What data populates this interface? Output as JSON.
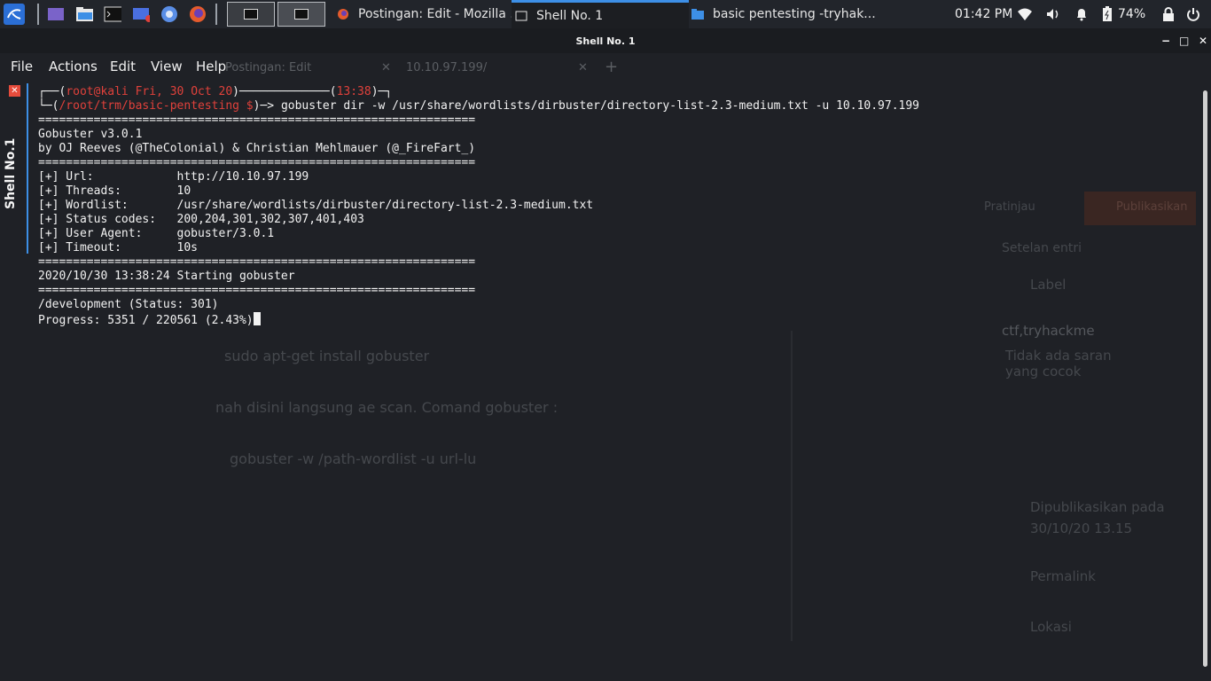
{
  "panel": {
    "taskbar": [
      {
        "label": "Postingan: Edit - Mozilla ...",
        "icon": "firefox-icon"
      },
      {
        "label": "Shell No. 1",
        "icon": "terminal-icon",
        "active": true
      },
      {
        "label": "basic pentesting -tryhak...",
        "icon": "folder-icon"
      }
    ],
    "clock": "01:42 PM",
    "battery": "74%"
  },
  "window": {
    "title": "Shell No. 1",
    "minimize": "−",
    "maximize": "□",
    "close": "✕"
  },
  "menu": {
    "file": "File",
    "actions": "Actions",
    "edit": "Edit",
    "view": "View",
    "help": "Help"
  },
  "side_tab": {
    "label": "Shell No.1",
    "close": "✕"
  },
  "background_ghost": {
    "tab1": "Postingan: Edit",
    "tab2": "10.10.97.199/",
    "sidebar_heading": "Setelan entri",
    "label_section": "Label",
    "tag": "ctf,tryhackme",
    "no_suggestion": "Tidak ada saran yang cocok",
    "published": "Dipublikasikan pada 30/10/20 13.15",
    "permalink": "Permalink",
    "location": "Lokasi",
    "post_line1": "sudo apt-get install gobuster",
    "post_line2": "nah disini langsung ae scan. Comand gobuster :",
    "post_line3": "gobuster -w /path-wordlist -u url-lu",
    "publish": "Publikasikan",
    "preview": "Pratinjau"
  },
  "terminal": {
    "prompt_line1": {
      "pre": "┌──(",
      "userhost": "root@kali Fri, 30 Oct 20",
      "mid": ")─────────────(",
      "time": "13:38",
      "post": ")─┐"
    },
    "prompt_line2": {
      "pre": "└─(",
      "path": "/root/trm/basic-pentesting $",
      "post": ")─> ",
      "command": "gobuster dir -w /usr/share/wordlists/dirbuster/directory-list-2.3-medium.txt -u 10.10.97.199"
    },
    "output": [
      "===============================================================",
      "Gobuster v3.0.1",
      "by OJ Reeves (@TheColonial) & Christian Mehlmauer (@_FireFart_)",
      "===============================================================",
      "[+] Url:            http://10.10.97.199",
      "[+] Threads:        10",
      "[+] Wordlist:       /usr/share/wordlists/dirbuster/directory-list-2.3-medium.txt",
      "[+] Status codes:   200,204,301,302,307,401,403",
      "[+] User Agent:     gobuster/3.0.1",
      "[+] Timeout:        10s",
      "===============================================================",
      "2020/10/30 13:38:24 Starting gobuster",
      "===============================================================",
      "/development (Status: 301)"
    ],
    "progress": "Progress: 5351 / 220561 (2.43%)"
  },
  "colors": {
    "accent": "#3d8fe6",
    "prompt_red": "#e0413b",
    "close_red": "#e74c3c"
  }
}
